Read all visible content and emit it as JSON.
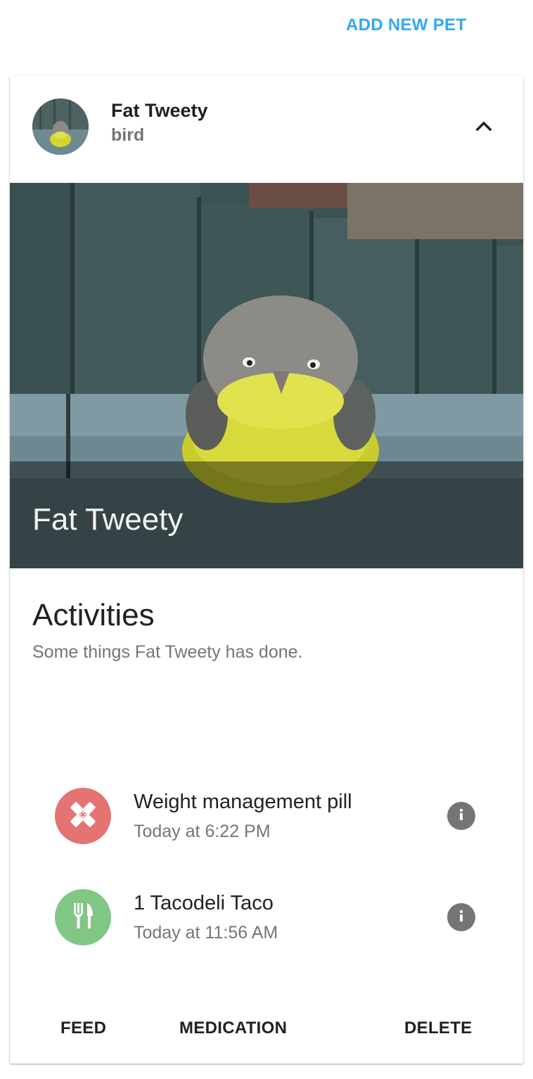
{
  "header": {
    "add_pet_label": "ADD NEW PET"
  },
  "pet": {
    "name": "Fat Tweety",
    "type": "bird",
    "media_title": "Fat Tweety",
    "collapse_icon": "chevron-up-icon"
  },
  "activities": {
    "title": "Activities",
    "subtitle": "Some things Fat Tweety has done.",
    "items": [
      {
        "title": "Weight management pill",
        "time": "Today at 6:22 PM",
        "icon": "bandage-icon",
        "color": "#e57373"
      },
      {
        "title": "1 Tacodeli Taco",
        "time": "Today at 11:56 AM",
        "icon": "utensils-icon",
        "color": "#81c784"
      }
    ]
  },
  "actions": {
    "feed": "FEED",
    "medication": "MEDICATION",
    "delete": "DELETE"
  },
  "colors": {
    "accent": "#33a8f0",
    "medication": "#e57373",
    "food": "#81c784",
    "info": "#757575"
  }
}
